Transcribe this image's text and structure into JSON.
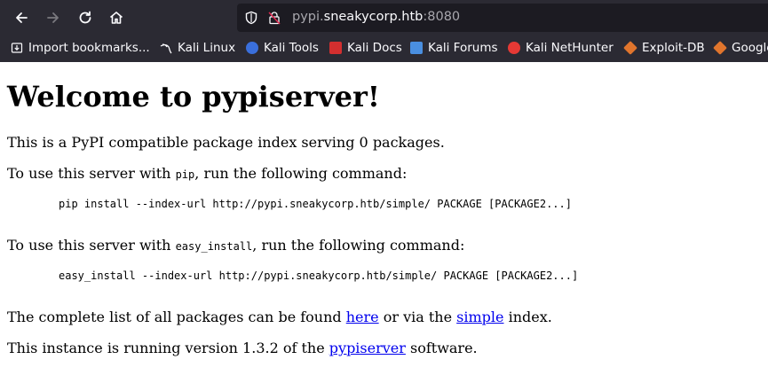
{
  "browser": {
    "url_host_prefix": "pypi.",
    "url_host_main": "sneakycorp.htb",
    "url_port": ":8080"
  },
  "bookmarks": [
    {
      "label": "Import bookmarks...",
      "icon": "import-icon"
    },
    {
      "label": "Kali Linux",
      "icon": "kali-dragon-icon"
    },
    {
      "label": "Kali Tools",
      "icon": "kali-tools-icon"
    },
    {
      "label": "Kali Docs",
      "icon": "kali-docs-icon"
    },
    {
      "label": "Kali Forums",
      "icon": "kali-forums-icon"
    },
    {
      "label": "Kali NetHunter",
      "icon": "kali-nethunter-icon"
    },
    {
      "label": "Exploit-DB",
      "icon": "exploit-db-icon"
    },
    {
      "label": "Google",
      "icon": "google-hacking-icon"
    }
  ],
  "page": {
    "title": "Welcome to pypiserver!",
    "intro": "This is a PyPI compatible package index serving 0 packages.",
    "pip_prefix": "To use this server with ",
    "pip_code": "pip",
    "pip_suffix": ", run the following command:",
    "pip_command": "pip install --index-url http://pypi.sneakycorp.htb/simple/ PACKAGE [PACKAGE2...]",
    "easy_prefix": "To use this server with ",
    "easy_code": "easy_install",
    "easy_suffix": ", run the following command:",
    "easy_command": "easy_install --index-url http://pypi.sneakycorp.htb/simple/ PACKAGE [PACKAGE2...]",
    "list_prefix": "The complete list of all packages can be found ",
    "list_here_link": "here",
    "list_middle": " or via the ",
    "list_simple_link": "simple",
    "list_suffix": " index.",
    "version_prefix": "This instance is running version 1.3.2 of the ",
    "version_link": "pypiserver",
    "version_suffix": " software."
  }
}
